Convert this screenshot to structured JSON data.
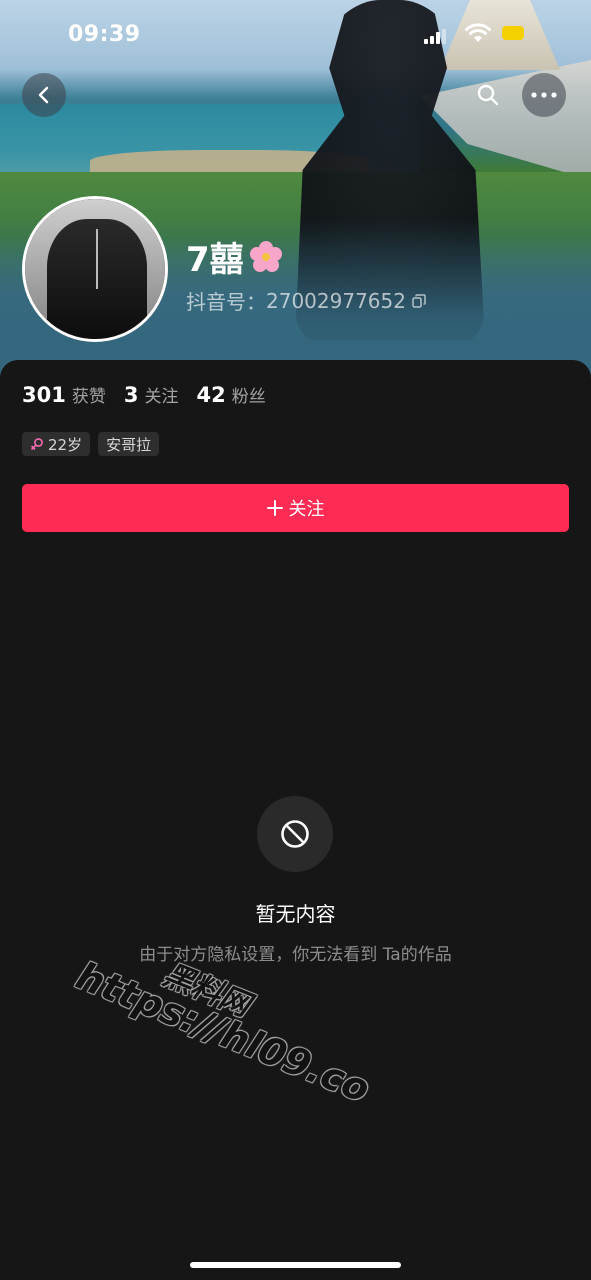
{
  "status_bar": {
    "time": "09:39"
  },
  "profile": {
    "nickname": "7囍",
    "douyin_id_label": "抖音号：",
    "douyin_id": "27002977652"
  },
  "stats": [
    {
      "num": "301",
      "label": "获赞"
    },
    {
      "num": "3",
      "label": "关注"
    },
    {
      "num": "42",
      "label": "粉丝"
    }
  ],
  "tags": {
    "age": "22岁",
    "location": "安哥拉"
  },
  "follow_button": {
    "label": "关注"
  },
  "empty_state": {
    "title": "暂无内容",
    "description": "由于对方隐私设置，你无法看到 Ta的作品"
  },
  "watermark": {
    "line1": "黑料网",
    "line2": "https://hl09.co"
  },
  "colors": {
    "accent": "#fe2c55",
    "background": "#161616",
    "battery": "#f5d000"
  },
  "icons": [
    "back-icon",
    "search-icon",
    "more-icon",
    "copy-icon",
    "female-icon",
    "plus-icon",
    "forbidden-icon",
    "flower-icon"
  ]
}
